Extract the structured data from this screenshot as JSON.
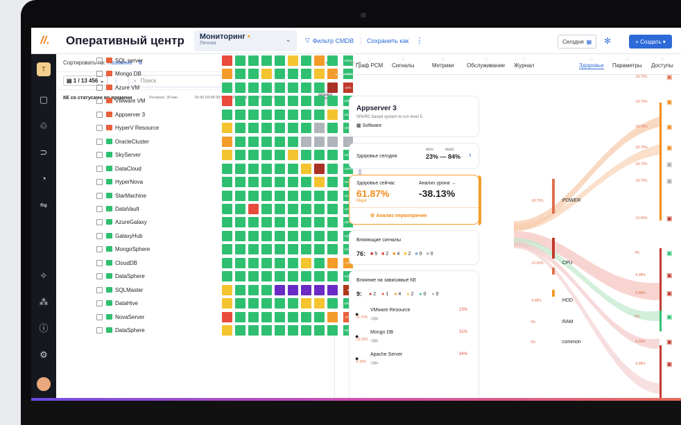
{
  "app": {
    "logo": "//.",
    "title": "Оперативный центр"
  },
  "monitoring": {
    "title": "Мониторинг",
    "subtitle": "Личная"
  },
  "toolbar": {
    "filter": "Фильтр CMDB",
    "save": "Сохранить как",
    "today": "Сегодня",
    "create": "Создать"
  },
  "sidebar": {
    "avatar": "T"
  },
  "list": {
    "sort_label": "Сортировать по:",
    "sort_value": "Название",
    "count": "1 / 13 456",
    "search_placeholder": "Поиск",
    "header": "КЕ со статусами во времени",
    "interval": "Интервал: 30 мин",
    "times": "01:00  02:00  03:00  04:00  5:00  6:00  7:00  8:00  9:00",
    "now": "Здоровье сейчас",
    "items": [
      {
        "name": "SQL server",
        "icon_color": "#e8603c",
        "cells": [
          "r",
          "g",
          "g",
          "g",
          "g",
          "y",
          "g",
          "o",
          "g"
        ],
        "pct": "100%",
        "pct_color": "#2fbf71"
      },
      {
        "name": "Mongo DB",
        "icon_color": "#e8603c",
        "cells": [
          "o",
          "g",
          "g",
          "y",
          "g",
          "g",
          "g",
          "y",
          "o"
        ],
        "pct": "100%",
        "pct_color": "#2fbf71"
      },
      {
        "name": "Azure VM",
        "icon_color": "#e8603c",
        "cells": [
          "g",
          "g",
          "g",
          "g",
          "g",
          "g",
          "g",
          "g",
          "dr"
        ],
        "pct": "21%",
        "pct_color": "#c0392b"
      },
      {
        "name": "VMware VM",
        "icon_color": "#e8603c",
        "cells": [
          "r",
          "g",
          "g",
          "g",
          "g",
          "g",
          "g",
          "g",
          "g"
        ],
        "pct": "100%",
        "pct_color": "#2fbf71"
      },
      {
        "name": "Appserver 3",
        "icon_color": "#e8603c",
        "cells": [
          "g",
          "g",
          "g",
          "g",
          "g",
          "g",
          "g",
          "g",
          "y"
        ],
        "pct": "100%",
        "pct_color": "#2fbf71"
      },
      {
        "name": "HyperV Resource",
        "icon_color": "#e8603c",
        "cells": [
          "y",
          "g",
          "g",
          "g",
          "g",
          "g",
          "g",
          "gr",
          "g"
        ],
        "pct": "100%",
        "pct_color": "#2fbf71"
      },
      {
        "name": "OracleCluster",
        "icon_color": "#2fbf71",
        "cells": [
          "o",
          "g",
          "g",
          "g",
          "g",
          "g",
          "gr",
          "gr",
          "gr"
        ],
        "pct": "-",
        "pct_color": "#b0b4bb"
      },
      {
        "name": "SkyServer",
        "icon_color": "#2fbf71",
        "cells": [
          "y",
          "g",
          "g",
          "g",
          "g",
          "y",
          "g",
          "g",
          "g"
        ],
        "pct": "100%",
        "pct_color": "#2fbf71"
      },
      {
        "name": "DataCloud",
        "icon_color": "#2fbf71",
        "cells": [
          "g",
          "g",
          "g",
          "g",
          "g",
          "g",
          "y",
          "dr",
          "g"
        ],
        "pct": "100%",
        "pct_color": "#2fbf71"
      },
      {
        "name": "HyperNova",
        "icon_color": "#2fbf71",
        "cells": [
          "g",
          "g",
          "g",
          "g",
          "g",
          "g",
          "g",
          "y",
          "g"
        ],
        "pct": "100%",
        "pct_color": "#2fbf71"
      },
      {
        "name": "StarMachine",
        "icon_color": "#2fbf71",
        "cells": [
          "g",
          "g",
          "g",
          "g",
          "g",
          "g",
          "g",
          "g",
          "g"
        ],
        "pct": "100%",
        "pct_color": "#2fbf71"
      },
      {
        "name": "DataVault",
        "icon_color": "#2fbf71",
        "cells": [
          "g",
          "g",
          "r",
          "g",
          "g",
          "g",
          "g",
          "g",
          "g"
        ],
        "pct": "100%",
        "pct_color": "#2fbf71"
      },
      {
        "name": "AzureGalaxy",
        "icon_color": "#2fbf71",
        "cells": [
          "g",
          "g",
          "g",
          "g",
          "g",
          "g",
          "g",
          "g",
          "g"
        ],
        "pct": "100%",
        "pct_color": "#2fbf71"
      },
      {
        "name": "GalaxyHub",
        "icon_color": "#2fbf71",
        "cells": [
          "g",
          "g",
          "g",
          "g",
          "g",
          "g",
          "g",
          "g",
          "g"
        ],
        "pct": "100%",
        "pct_color": "#2fbf71"
      },
      {
        "name": "MongoSphere",
        "icon_color": "#2fbf71",
        "cells": [
          "g",
          "g",
          "g",
          "g",
          "g",
          "g",
          "g",
          "g",
          "g"
        ],
        "pct": "100%",
        "pct_color": "#2fbf71"
      },
      {
        "name": "CloudDB",
        "icon_color": "#2fbf71",
        "cells": [
          "g",
          "g",
          "g",
          "g",
          "g",
          "g",
          "y",
          "g",
          "o"
        ],
        "pct": "77%",
        "pct_color": "#f39c2a"
      },
      {
        "name": "DataSphere",
        "icon_color": "#2fbf71",
        "cells": [
          "g",
          "g",
          "g",
          "g",
          "g",
          "g",
          "g",
          "g",
          "g"
        ],
        "pct": "100%",
        "pct_color": "#2fbf71"
      },
      {
        "name": "SQLMaster",
        "icon_color": "#2fbf71",
        "cells": [
          "y",
          "g",
          "g",
          "g",
          "p",
          "p",
          "p",
          "p",
          "p"
        ],
        "pct": "0",
        "pct_color": "#b0391b"
      },
      {
        "name": "DataHive",
        "icon_color": "#2fbf71",
        "cells": [
          "y",
          "g",
          "g",
          "g",
          "g",
          "g",
          "y",
          "y",
          "g"
        ],
        "pct": "100%",
        "pct_color": "#2fbf71"
      },
      {
        "name": "NovaServer",
        "icon_color": "#2fbf71",
        "cells": [
          "r",
          "g",
          "g",
          "g",
          "g",
          "g",
          "g",
          "g",
          "o"
        ],
        "pct": "27%",
        "pct_color": "#e8603c"
      },
      {
        "name": "DataSphere",
        "icon_color": "#2fbf71",
        "cells": [
          "y",
          "g",
          "g",
          "g",
          "g",
          "g",
          "g",
          "g",
          "g"
        ],
        "pct": "100%",
        "pct_color": "#2fbf71"
      }
    ]
  },
  "tabs": [
    {
      "label": "Граф РСМ"
    },
    {
      "label": "Сигналы"
    },
    {
      "label": "Метрики"
    },
    {
      "label": "Обслуживание"
    },
    {
      "label": "Журнал"
    },
    {
      "label": "Здоровье"
    },
    {
      "label": "Параметры"
    },
    {
      "label": "Доступы"
    }
  ],
  "detail": {
    "title": "Appserver 3",
    "desc": "SPARC based system to run level 5",
    "type": "Software",
    "today_label": "Здоровье сегодня",
    "min_label": "мин",
    "max_label": "макс",
    "range": "23% — 84%",
    "now_label": "Здоровье сейчас",
    "now_value": "61.87%",
    "now_status": "Major",
    "damage_label": "Анализ урона →",
    "damage_value": "-38.13%",
    "rca": "Анализ первопричин",
    "signals_label": "Влияющие сигналы",
    "signals_total": "76:",
    "signals": [
      "5",
      "2",
      "4",
      "2",
      "0",
      "0"
    ],
    "dep_label": "Влияние на зависимые КЕ",
    "dep_total": "9:",
    "dep_counts": [
      "2",
      "1",
      "4",
      "2",
      "0",
      "0"
    ],
    "deps": [
      {
        "name": "VMware Resource",
        "pct": "-11.75%",
        "sub": ":cpu",
        "trend": "23%"
      },
      {
        "name": "Mongo DB",
        "pct": "-10.23%",
        "sub": ":cpu",
        "trend": "31%"
      },
      {
        "name": "Apache Server",
        "pct": "-9.16%",
        "sub": ":cpu",
        "trend": "34%"
      }
    ]
  },
  "flow": {
    "nodes": [
      ":POWER",
      ":CPU",
      ":HDD",
      ":RAM",
      ":common"
    ],
    "node_pcts": [
      "-18.75%",
      "-12.50%",
      "-6.88%",
      "0%",
      "0%"
    ],
    "leaves": [
      "-18.75%",
      "-18.75%",
      "-18.75%",
      "-18.75%",
      "-18.75%",
      "-18.75%",
      "-12.50%",
      "0%",
      "-6.88%",
      "-6.88%",
      "0%",
      "-6.88%",
      "-6.88%",
      "0%"
    ]
  }
}
